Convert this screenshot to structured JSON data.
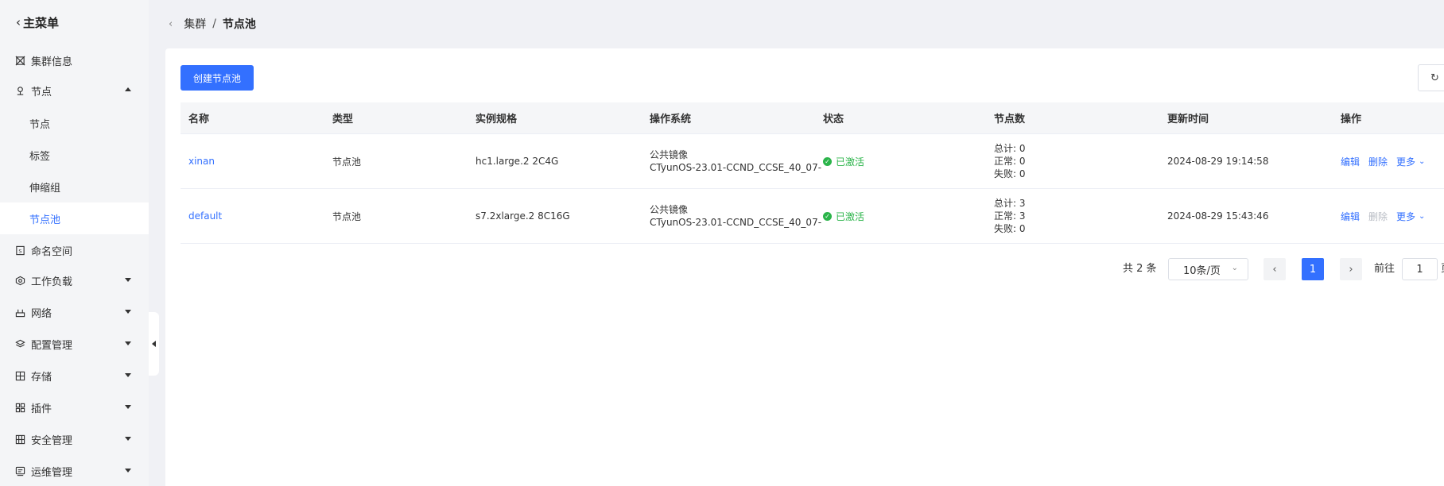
{
  "sidebar": {
    "header": "主菜单",
    "items": [
      {
        "label": "集群信息"
      },
      {
        "label": "节点"
      },
      {
        "label": "命名空间"
      },
      {
        "label": "工作负载"
      },
      {
        "label": "网络"
      },
      {
        "label": "配置管理"
      },
      {
        "label": "存储"
      },
      {
        "label": "插件"
      },
      {
        "label": "安全管理"
      },
      {
        "label": "运维管理"
      }
    ],
    "sub_items": [
      {
        "label": "节点"
      },
      {
        "label": "标签"
      },
      {
        "label": "伸缩组"
      },
      {
        "label": "节点池"
      }
    ]
  },
  "breadcrumb": {
    "parent": "集群",
    "separator": "/",
    "current": "节点池"
  },
  "toolbar": {
    "create_label": "创建节点池"
  },
  "table": {
    "columns": [
      "名称",
      "类型",
      "实例规格",
      "操作系统",
      "状态",
      "节点数",
      "更新时间",
      "操作"
    ],
    "rows": [
      {
        "name": "xinan",
        "type": "节点池",
        "spec": "hc1.large.2 2C4G",
        "os_line1": "公共镜像",
        "os_line2": "CTyunOS-23.01-CCND_CCSE_40_07-",
        "status": "已激活",
        "nodes_total": "总计: 0",
        "nodes_normal": "正常: 0",
        "nodes_failed": "失败: 0",
        "updated": "2024-08-29 19:14:58",
        "op_edit": "编辑",
        "op_delete": "删除",
        "op_more": "更多"
      },
      {
        "name": "default",
        "type": "节点池",
        "spec": "s7.2xlarge.2 8C16G",
        "os_line1": "公共镜像",
        "os_line2": "CTyunOS-23.01-CCND_CCSE_40_07-",
        "status": "已激活",
        "nodes_total": "总计: 3",
        "nodes_normal": "正常: 3",
        "nodes_failed": "失败: 0",
        "updated": "2024-08-29 15:43:46",
        "op_edit": "编辑",
        "op_delete": "删除",
        "op_more": "更多"
      }
    ]
  },
  "pagination": {
    "total": "共 2 条",
    "page_size": "10条/页",
    "current_page": "1",
    "goto_label": "前往",
    "goto_value": "1",
    "goto_suffix": "页"
  },
  "colors": {
    "accent": "#3370ff",
    "success": "#2bb44a",
    "disabled": "#b8bcc4"
  }
}
